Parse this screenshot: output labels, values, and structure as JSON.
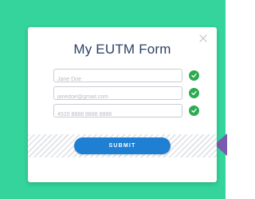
{
  "form": {
    "title": "My EUTM Form",
    "fields": [
      {
        "value": "",
        "placeholder": "Jane Doe",
        "valid": true
      },
      {
        "value": "",
        "placeholder": "janedoe@gmail.com",
        "valid": true
      },
      {
        "value": "",
        "placeholder": "4520 8888 8888 8888",
        "valid": true
      }
    ],
    "submit_label": "SUBMIT"
  },
  "icons": {
    "close": "close-icon",
    "check": "check-circle-icon"
  },
  "colors": {
    "background": "#34d49c",
    "card": "#ffffff",
    "title": "#2d4064",
    "submit": "#1f7fd2",
    "check": "#2eab52",
    "side_tab": "#7b5bb0"
  }
}
